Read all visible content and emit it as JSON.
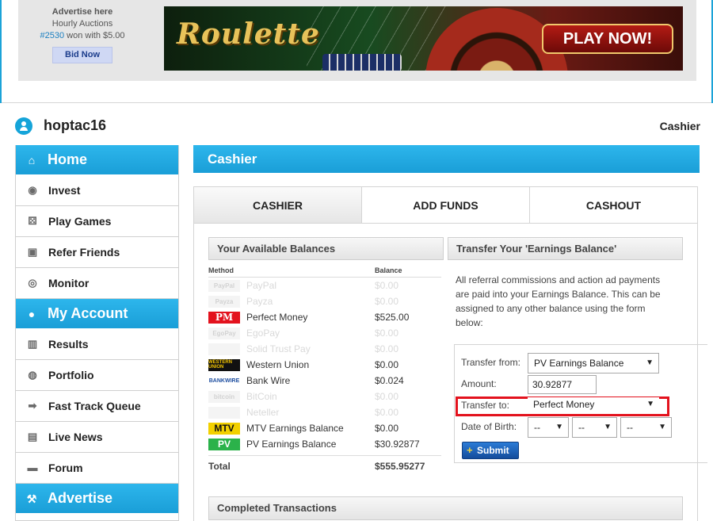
{
  "ad": {
    "title": "Advertise here",
    "subtitle": "Hourly Auctions",
    "auction_id": "#2530",
    "won_text": " won with $5.00",
    "bid_label": "Bid Now",
    "banner_logo": "Roulette",
    "banner_cta": "PLAY NOW!"
  },
  "user": {
    "name": "hoptac16",
    "page_label": "Cashier"
  },
  "sidebar": {
    "home": "Home",
    "home_items": [
      {
        "label": "Invest",
        "icon": "invest-icon"
      },
      {
        "label": "Play Games",
        "icon": "dice-icon"
      },
      {
        "label": "Refer Friends",
        "icon": "refer-icon"
      },
      {
        "label": "Monitor",
        "icon": "monitor-icon"
      }
    ],
    "account": "My Account",
    "account_items": [
      {
        "label": "Results",
        "icon": "bar-chart-icon"
      },
      {
        "label": "Portfolio",
        "icon": "portfolio-icon"
      },
      {
        "label": "Fast Track Queue",
        "icon": "fast-track-icon"
      },
      {
        "label": "Live News",
        "icon": "news-icon"
      },
      {
        "label": "Forum",
        "icon": "forum-icon"
      }
    ],
    "advertise": "Advertise"
  },
  "main": {
    "title": "Cashier",
    "tabs": [
      "CASHIER",
      "ADD FUNDS",
      "CASHOUT"
    ]
  },
  "balances": {
    "title": "Your Available Balances",
    "col_method": "Method",
    "col_balance": "Balance",
    "rows": [
      {
        "logo": "PayPal",
        "name": "PayPal",
        "balance": "$0.00",
        "dim": true
      },
      {
        "logo": "Payza",
        "name": "Payza",
        "balance": "$0.00",
        "dim": true
      },
      {
        "logo": "PM",
        "name": "Perfect Money",
        "balance": "$525.00",
        "dim": false
      },
      {
        "logo": "EgoPay",
        "name": "EgoPay",
        "balance": "$0.00",
        "dim": true
      },
      {
        "logo": "",
        "name": "Solid Trust Pay",
        "balance": "$0.00",
        "dim": true
      },
      {
        "logo": "WESTERN UNION",
        "name": "Western Union",
        "balance": "$0.00",
        "dim": false
      },
      {
        "logo": "BANKWIRE",
        "name": "Bank Wire",
        "balance": "$0.024",
        "dim": false
      },
      {
        "logo": "bitcoin",
        "name": "BitCoin",
        "balance": "$0.00",
        "dim": true
      },
      {
        "logo": "",
        "name": "Neteller",
        "balance": "$0.00",
        "dim": true
      },
      {
        "logo": "MTV",
        "name": "MTV Earnings Balance",
        "balance": "$0.00",
        "dim": false
      },
      {
        "logo": "PV",
        "name": "PV Earnings Balance",
        "balance": "$30.92877",
        "dim": false
      }
    ],
    "total_label": "Total",
    "total_value": "$555.95277"
  },
  "transfer": {
    "title": "Transfer Your 'Earnings Balance'",
    "description": "All referral commissions and action ad payments are paid into your Earnings Balance. This can be assigned to any other balance using the form below:",
    "from_label": "Transfer from:",
    "from_value": "PV Earnings Balance",
    "amount_label": "Amount:",
    "amount_value": "30.92877",
    "to_label": "Transfer to:",
    "to_value": "Perfect Money",
    "dob_label": "Date of Birth:",
    "dob_day": "--",
    "dob_month": "--",
    "dob_year": "--",
    "submit_label": "Submit"
  },
  "completed": {
    "title": "Completed Transactions"
  },
  "colors": {
    "accent": "#1ba3d8",
    "highlight": "#e3121d",
    "submit": "#1a5fb8"
  }
}
